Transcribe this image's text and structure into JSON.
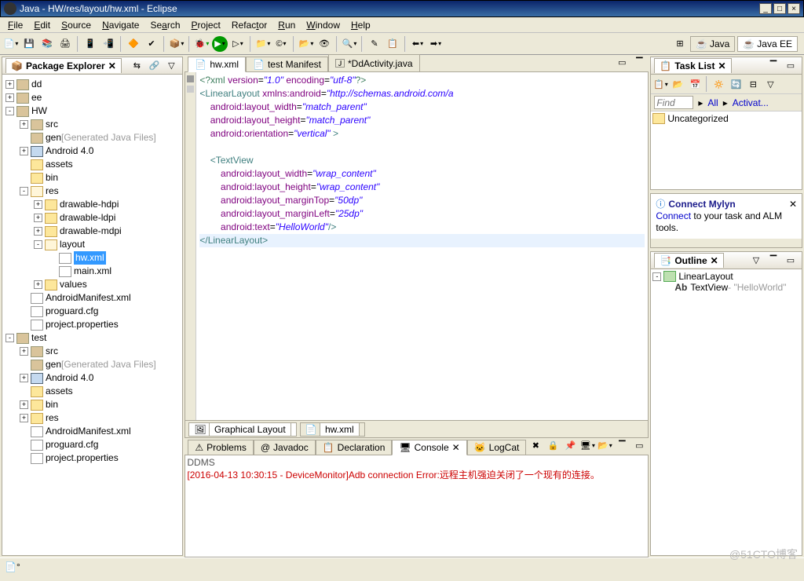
{
  "window": {
    "title": "Java - HW/res/layout/hw.xml - Eclipse"
  },
  "menu": {
    "file": "File",
    "edit": "Edit",
    "source": "Source",
    "navigate": "Navigate",
    "search": "Search",
    "project": "Project",
    "refactor": "Refactor",
    "run": "Run",
    "window": "Window",
    "help": "Help"
  },
  "perspectives": {
    "java": "Java",
    "javaee": "Java EE"
  },
  "pkgexplorer": {
    "title": "Package Explorer",
    "items": [
      {
        "d": 0,
        "exp": "+",
        "ic": "pkg",
        "label": "dd"
      },
      {
        "d": 0,
        "exp": "+",
        "ic": "pkg",
        "label": "ee"
      },
      {
        "d": 0,
        "exp": "-",
        "ic": "pkg",
        "label": "HW"
      },
      {
        "d": 1,
        "exp": "+",
        "ic": "pkg",
        "label": "src"
      },
      {
        "d": 1,
        "exp": "",
        "ic": "pkg",
        "label": "gen",
        "suffix": "[Generated Java Files]"
      },
      {
        "d": 1,
        "exp": "+",
        "ic": "jfile",
        "label": "Android 4.0"
      },
      {
        "d": 1,
        "exp": "",
        "ic": "folder",
        "label": "assets"
      },
      {
        "d": 1,
        "exp": "",
        "ic": "folder",
        "label": "bin"
      },
      {
        "d": 1,
        "exp": "-",
        "ic": "folderopen",
        "label": "res"
      },
      {
        "d": 2,
        "exp": "+",
        "ic": "folder",
        "label": "drawable-hdpi"
      },
      {
        "d": 2,
        "exp": "+",
        "ic": "folder",
        "label": "drawable-ldpi"
      },
      {
        "d": 2,
        "exp": "+",
        "ic": "folder",
        "label": "drawable-mdpi"
      },
      {
        "d": 2,
        "exp": "-",
        "ic": "folderopen",
        "label": "layout"
      },
      {
        "d": 3,
        "exp": "",
        "ic": "file",
        "label": "hw.xml",
        "sel": true
      },
      {
        "d": 3,
        "exp": "",
        "ic": "file",
        "label": "main.xml"
      },
      {
        "d": 2,
        "exp": "+",
        "ic": "folder",
        "label": "values"
      },
      {
        "d": 1,
        "exp": "",
        "ic": "file",
        "label": "AndroidManifest.xml"
      },
      {
        "d": 1,
        "exp": "",
        "ic": "file",
        "label": "proguard.cfg"
      },
      {
        "d": 1,
        "exp": "",
        "ic": "file",
        "label": "project.properties"
      },
      {
        "d": 0,
        "exp": "-",
        "ic": "pkg",
        "label": "test"
      },
      {
        "d": 1,
        "exp": "+",
        "ic": "pkg",
        "label": "src"
      },
      {
        "d": 1,
        "exp": "",
        "ic": "pkg",
        "label": "gen",
        "suffix": "[Generated Java Files]"
      },
      {
        "d": 1,
        "exp": "+",
        "ic": "jfile",
        "label": "Android 4.0"
      },
      {
        "d": 1,
        "exp": "",
        "ic": "folder",
        "label": "assets"
      },
      {
        "d": 1,
        "exp": "+",
        "ic": "folder",
        "label": "bin"
      },
      {
        "d": 1,
        "exp": "+",
        "ic": "folder",
        "label": "res"
      },
      {
        "d": 1,
        "exp": "",
        "ic": "file",
        "label": "AndroidManifest.xml"
      },
      {
        "d": 1,
        "exp": "",
        "ic": "file",
        "label": "proguard.cfg"
      },
      {
        "d": 1,
        "exp": "",
        "ic": "file",
        "label": "project.properties"
      }
    ]
  },
  "editor": {
    "tabs": [
      {
        "label": "hw.xml",
        "active": true
      },
      {
        "label": "test Manifest"
      },
      {
        "label": "*DdActivity.java"
      }
    ],
    "footer": {
      "graphical": "Graphical Layout",
      "source": "hw.xml"
    }
  },
  "bottom": {
    "tabs": {
      "problems": "Problems",
      "javadoc": "Javadoc",
      "declaration": "Declaration",
      "console": "Console",
      "logcat": "LogCat"
    },
    "console_header": "DDMS",
    "console_line": "[2016-04-13 10:30:15 - DeviceMonitor]Adb connection Error:远程主机强迫关闭了一个现有的连接。"
  },
  "tasklist": {
    "title": "Task List",
    "find_placeholder": "Find",
    "all": "All",
    "activate": "Activat...",
    "uncategorized": "Uncategorized"
  },
  "mylyn": {
    "title": "Connect Mylyn",
    "link": "Connect",
    "text": " to your task and ALM tools."
  },
  "outline": {
    "title": "Outline",
    "root": "LinearLayout",
    "child_prefix": "Ab",
    "child": "TextView",
    "child_suffix": " - \"HelloWorld\""
  },
  "watermark": "@51CTO博客"
}
